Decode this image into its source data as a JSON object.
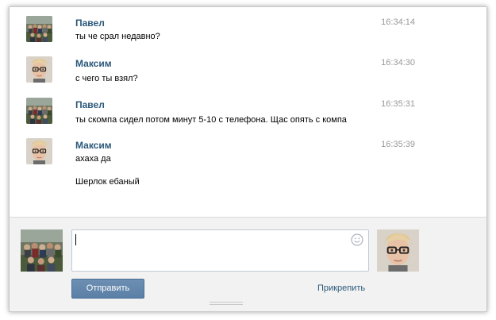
{
  "messages": [
    {
      "author": "Павел",
      "time": "16:34:14",
      "lines": [
        "ты че срал недавно?"
      ],
      "avatar": "group-photo"
    },
    {
      "author": "Максим",
      "time": "16:34:30",
      "lines": [
        "с чего ты взял?"
      ],
      "avatar": "boy-with-glasses"
    },
    {
      "author": "Павел",
      "time": "16:35:31",
      "lines": [
        "ты скомпа сидел потом минут 5-10 с телефона. Щас опять с компа"
      ],
      "avatar": "group-photo"
    },
    {
      "author": "Максим",
      "time": "16:35:39",
      "lines": [
        "ахаха да",
        "Шерлок ебаный"
      ],
      "avatar": "boy-with-glasses"
    }
  ],
  "composer": {
    "input_value": "",
    "send_label": "Отправить",
    "attach_label": "Прикрепить",
    "emoji_icon": "smile-icon"
  },
  "colors": {
    "author": "#2b587a",
    "time": "#999999",
    "button": "#5b7fa6",
    "composer_bg": "#f2f2f2"
  }
}
